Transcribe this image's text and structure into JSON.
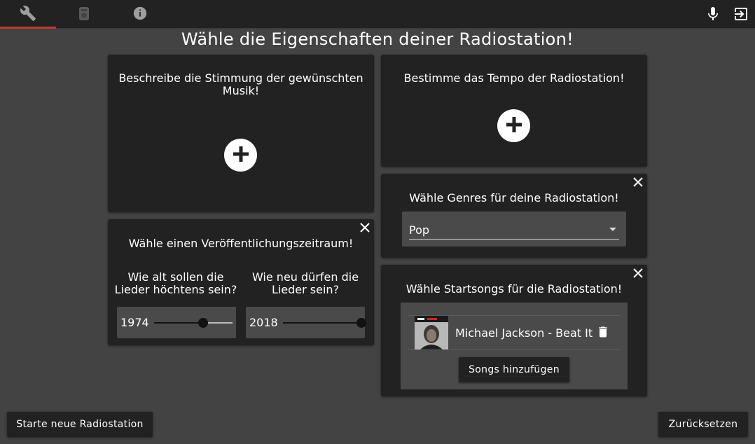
{
  "topbar": {
    "tabs": [
      {
        "icon": "wrench-icon",
        "active": true
      },
      {
        "icon": "radio-icon",
        "active": false
      },
      {
        "icon": "info-icon",
        "active": false
      }
    ],
    "right_icons": [
      "microphone-icon",
      "logout-icon"
    ],
    "accent": "#c0392b"
  },
  "page": {
    "title": "Wähle die Eigenschaften deiner Radiostation!"
  },
  "mood_card": {
    "title": "Beschreibe die Stimmung der gewünschten Musik!"
  },
  "tempo_card": {
    "title": "Bestimme das Tempo der Radiostation!"
  },
  "period_card": {
    "title": "Wähle einen Veröffentlichungszeitraum!",
    "from_question": "Wie alt sollen die Lieder höchtens sein?",
    "to_question": "Wie neu dürfen die Lieder sein?",
    "from_value": "1974",
    "to_value": "2018",
    "from_fraction": 0.62,
    "to_fraction": 1.0
  },
  "genre_card": {
    "title": "Wähle Genres für deine Radiostation!",
    "selected": "Pop"
  },
  "songs_card": {
    "title": "Wähle Startsongs für die Radiostation!",
    "songs": [
      {
        "title": "Michael Jackson - Beat It"
      }
    ],
    "add_label": "Songs hinzufügen"
  },
  "footer": {
    "start_label": "Starte neue Radiostation",
    "reset_label": "Zurücksetzen"
  }
}
